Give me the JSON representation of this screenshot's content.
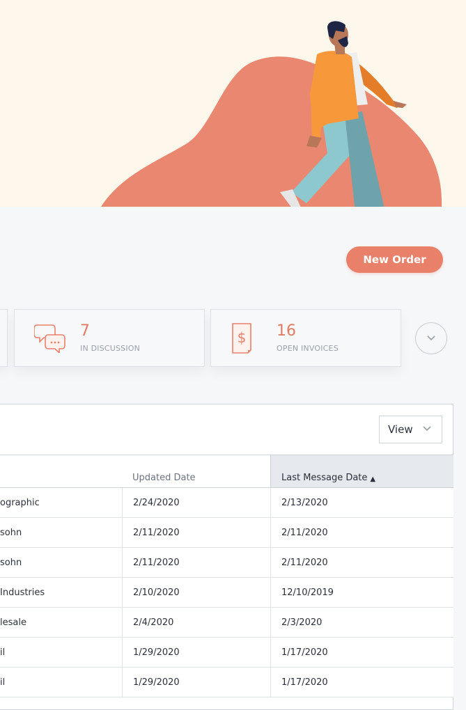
{
  "actions": {
    "new_order_label": "New Order"
  },
  "summary_cards": [
    {
      "count": "7",
      "label": "IN DISCUSSION",
      "icon": "chat-bubbles-icon"
    },
    {
      "count": "16",
      "label": "OPEN INVOICES",
      "icon": "invoice-dollar-icon"
    }
  ],
  "panel": {
    "view_label": "View"
  },
  "table": {
    "columns": [
      "Updated Date",
      "Last Message Date"
    ],
    "sort_indicator": "▲",
    "rows": [
      {
        "name": "ographic",
        "updated": "2/24/2020",
        "last_message": "2/13/2020"
      },
      {
        "name": "sohn",
        "updated": "2/11/2020",
        "last_message": "2/11/2020"
      },
      {
        "name": "sohn",
        "updated": "2/11/2020",
        "last_message": "2/11/2020"
      },
      {
        "name": "Industries",
        "updated": "2/10/2020",
        "last_message": "12/10/2019"
      },
      {
        "name": "lesale",
        "updated": "2/4/2020",
        "last_message": "2/3/2020"
      },
      {
        "name": "il",
        "updated": "1/29/2020",
        "last_message": "1/17/2020"
      },
      {
        "name": "il",
        "updated": "1/29/2020",
        "last_message": "1/17/2020"
      }
    ]
  },
  "colors": {
    "accent": "#e8806a",
    "hero_bg": "#fdf7ec",
    "page_bg": "#f6f7f9"
  }
}
